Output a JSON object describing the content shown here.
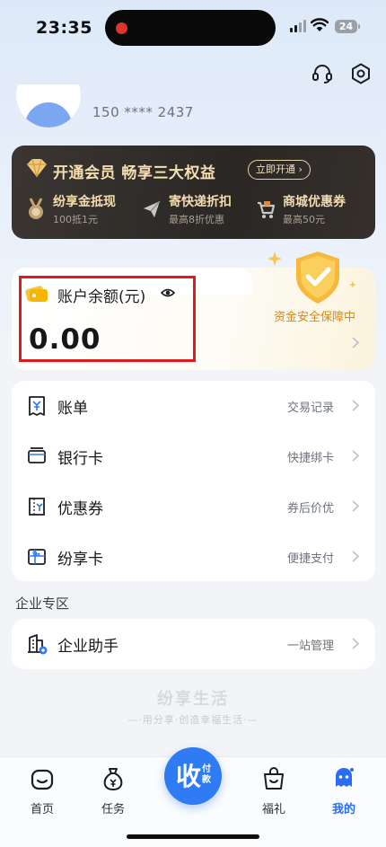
{
  "status_bar": {
    "time": "23:35",
    "battery": "24"
  },
  "profile": {
    "phone": "150 **** 2437"
  },
  "vip": {
    "title": "开通会员 畅享三大权益",
    "button": "立即开通 ›",
    "perks": [
      {
        "title": "纷享金抵现",
        "sub": "100抵1元"
      },
      {
        "title": "寄快递折扣",
        "sub": "最高8折优惠"
      },
      {
        "title": "商城优惠券",
        "sub": "最高50元"
      }
    ]
  },
  "balance": {
    "label": "账户余额(元)",
    "amount": "0.00",
    "safety": "资金安全保障中"
  },
  "menu": [
    {
      "label": "账单",
      "right": "交易记录"
    },
    {
      "label": "银行卡",
      "right": "快捷绑卡"
    },
    {
      "label": "优惠券",
      "right": "券后价优"
    },
    {
      "label": "纷享卡",
      "right": "便捷支付"
    }
  ],
  "enterprise": {
    "section_title": "企业专区",
    "label": "企业助手",
    "right": "一站管理"
  },
  "brand": {
    "name": "纷享生活",
    "slogan": "—·用分享·创造幸福生活·—"
  },
  "tabbar": {
    "items": [
      {
        "label": "首页"
      },
      {
        "label": "任务"
      },
      {
        "label": "福礼"
      },
      {
        "label": "我的"
      }
    ],
    "center_big": "收",
    "center_small": "付款",
    "active_color": "#2a6df4"
  },
  "colors": {
    "accent": "#2e7bf3",
    "gold": "#f6dfb2",
    "highlight_box": "#e0191c"
  }
}
